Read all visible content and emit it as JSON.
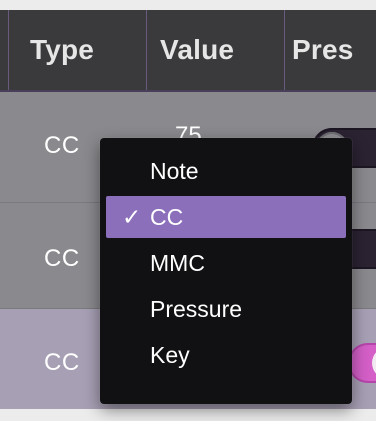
{
  "table": {
    "headers": {
      "type": "Type",
      "value": "Value",
      "pressure": "Pres"
    },
    "rows": [
      {
        "type": "CC",
        "value": "75",
        "toggle_on": false,
        "selected": false
      },
      {
        "type": "CC",
        "value": "",
        "toggle_on": false,
        "selected": false
      },
      {
        "type": "CC",
        "value": "",
        "toggle_on": true,
        "selected": true
      }
    ]
  },
  "dropdown": {
    "checkmark": "✓",
    "selected_value": "CC",
    "options": [
      "Note",
      "CC",
      "MMC",
      "Pressure",
      "Key"
    ]
  },
  "colors": {
    "header_bg": "#3a3a3c",
    "row_bg": "#8a898d",
    "selected_row_bg": "#a79fb4",
    "menu_bg": "#111113",
    "menu_highlight": "#8b6fbb",
    "toggle_on": "#d35fc7"
  }
}
